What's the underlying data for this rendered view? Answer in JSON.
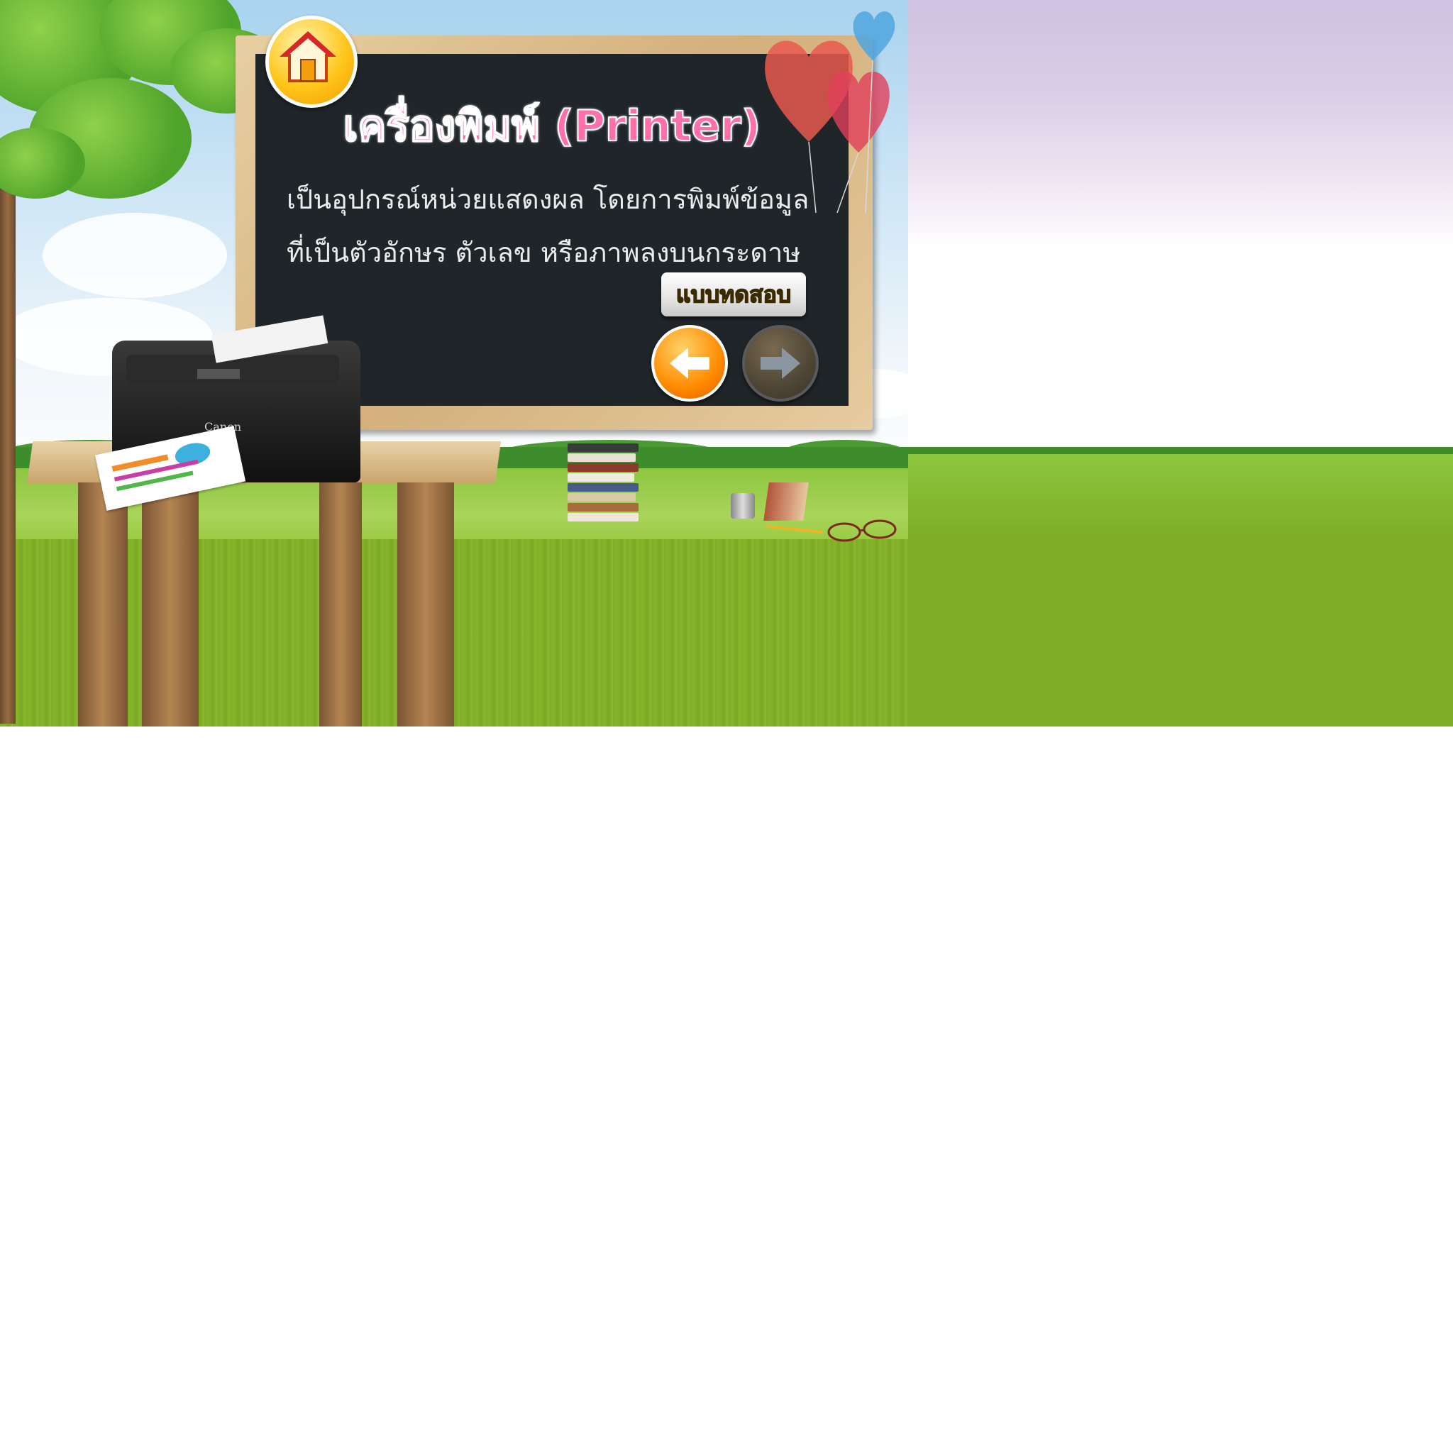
{
  "title": "เครื่องพิมพ์ (Printer)",
  "description_lines": [
    "เป็นอุปกรณ์หน่วยแสดงผล โดยการพิมพ์ข้อมูล",
    "ที่เป็นตัวอักษร ตัวเลข หรือภาพลงบนกระดาษ"
  ],
  "buttons": {
    "home_icon": "home-icon",
    "quiz_label": "แบบทดสอบ",
    "prev_icon": "arrow-left-icon",
    "next_icon": "arrow-right-icon"
  },
  "printer_brand": "Canon",
  "colors": {
    "title": "#ff6fa9",
    "board": "#1f2529",
    "quiz_text": "#ffd400",
    "prev_button": "#ff8a00",
    "next_button": "#4e4535"
  }
}
